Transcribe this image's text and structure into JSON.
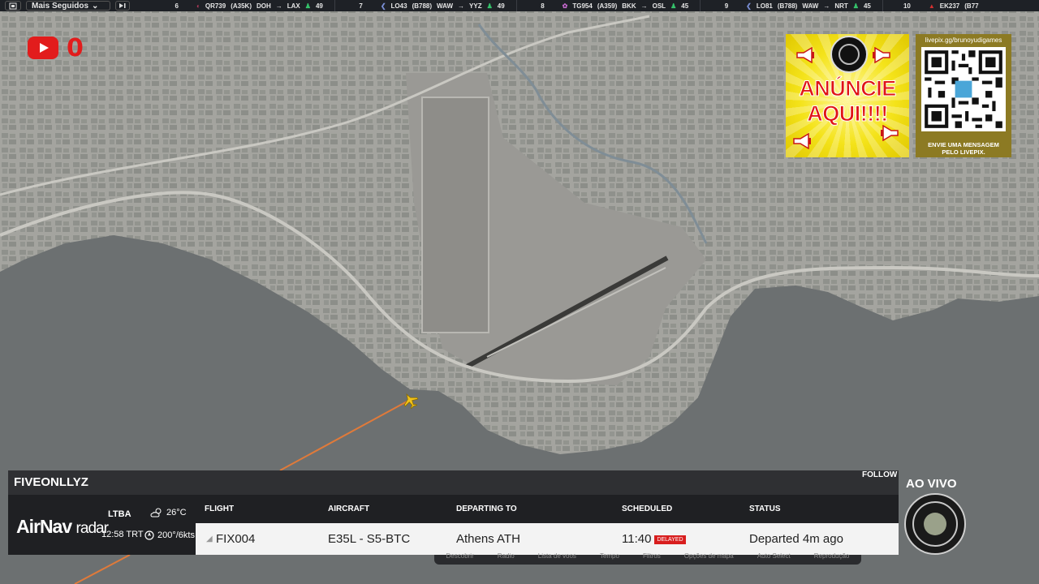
{
  "topbar": {
    "menu_label": "Mais Seguidos",
    "ticker": [
      {
        "rank": "6",
        "flight": "QR739",
        "aircraft": "(A35K)",
        "from": "DOH",
        "to": "LAX",
        "followers": "49"
      },
      {
        "rank": "7",
        "flight": "LO43",
        "aircraft": "(B788)",
        "from": "WAW",
        "to": "YYZ",
        "followers": "49"
      },
      {
        "rank": "8",
        "flight": "TG954",
        "aircraft": "(A359)",
        "from": "BKK",
        "to": "OSL",
        "followers": "45"
      },
      {
        "rank": "9",
        "flight": "LO81",
        "aircraft": "(B788)",
        "from": "WAW",
        "to": "NRT",
        "followers": "45"
      },
      {
        "rank": "10",
        "flight": "EK237",
        "aircraft": "(B77",
        "from": "",
        "to": "",
        "followers": ""
      }
    ]
  },
  "youtube": {
    "count": "0"
  },
  "ad": {
    "line1": "ANÚNCIE",
    "line2": "AQUI!!!!"
  },
  "qr": {
    "url": "livepix.gg/brunoyudigames",
    "message_line1": "ENVIE UMA MENSAGEM",
    "message_line2": "PELO LIVEPIX."
  },
  "flight_panel": {
    "callsign": "FIVEONLLYZ",
    "follow_label": "FOLLOW",
    "brand_main": "AirNav",
    "brand_sub": "radar",
    "airport": "LTBA",
    "local_time": "12:58 TRT",
    "temperature": "26°C",
    "wind": "200°/6kts",
    "headers": {
      "flight": "FLIGHT",
      "aircraft": "AIRCRAFT",
      "departing": "DEPARTING TO",
      "scheduled": "SCHEDULED",
      "status": "STATUS"
    },
    "row": {
      "flight": "FIX004",
      "aircraft": "E35L - S5-BTC",
      "departing": "Athens ATH",
      "scheduled": "11:40",
      "badge": "DELAYED",
      "status": "Departed 4m ago"
    }
  },
  "subtoolbar": [
    "Descobrir",
    "Radio",
    "Lista de voos",
    "Tempo",
    "Filtros",
    "Opções de mapa",
    "Auto Select",
    "Reprodução"
  ],
  "live": {
    "label": "AO VIVO"
  },
  "colors": {
    "topbar": "#1e2126",
    "youtube_red": "#e21c1c",
    "ad_yellow": "#f4e31a",
    "panel_dark": "#1f2023",
    "track_orange": "#e07a3a",
    "aircraft_yellow": "#f2c21a"
  }
}
